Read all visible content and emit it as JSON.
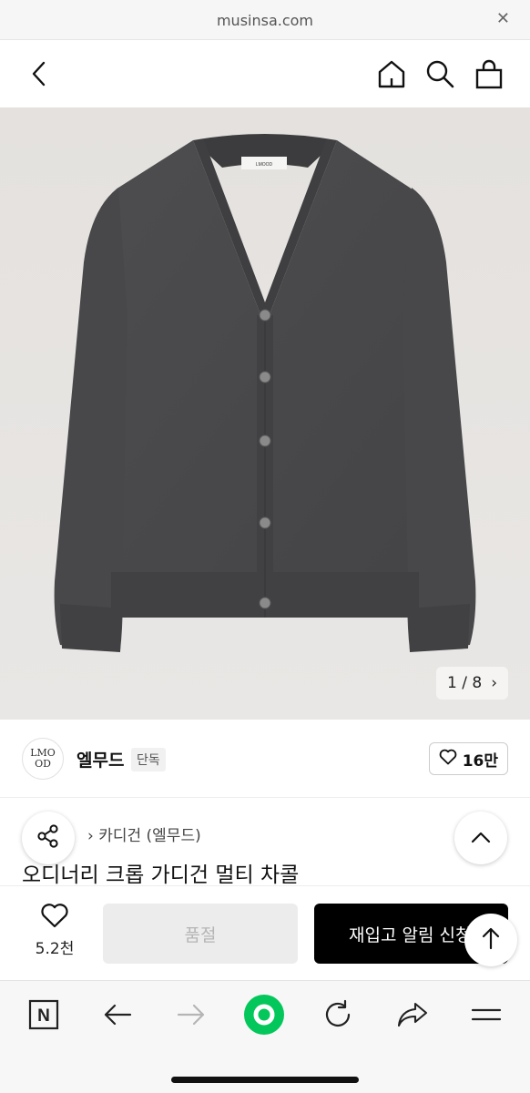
{
  "browser": {
    "url": "musinsa.com",
    "close_glyph": "✕"
  },
  "header": {
    "icons": [
      "back-icon",
      "home-icon",
      "search-icon",
      "shopping-bag-icon"
    ]
  },
  "gallery": {
    "current": "1",
    "separator": "/",
    "total": "8",
    "counter_text": "1 / 8",
    "next_glyph": "›",
    "label_tag_text": "LMOOD"
  },
  "brand": {
    "logo_text": "LMOOD",
    "name": "엘무드",
    "badge": "단독",
    "like_count": "16만"
  },
  "product": {
    "category_text": "› 카디건 (엘무드)",
    "title": "오디너리 크롭 가디건 멀티 차콜"
  },
  "purchase": {
    "wish_count": "5.2천",
    "soldout_label": "품절",
    "restock_label": "재입고 알림 신청"
  },
  "colors": {
    "accent_green": "#03c75a",
    "primary_button": "#000000",
    "disabled_button": "#ececec",
    "hero_background": "#e6e3e0",
    "cardigan": "#4a4a4b"
  },
  "toolbar": {
    "icons": [
      "naver-n-icon",
      "back-arrow-icon",
      "forward-arrow-icon",
      "green-dot-icon",
      "refresh-icon",
      "share-icon",
      "menu-icon"
    ],
    "n_label": "N"
  }
}
